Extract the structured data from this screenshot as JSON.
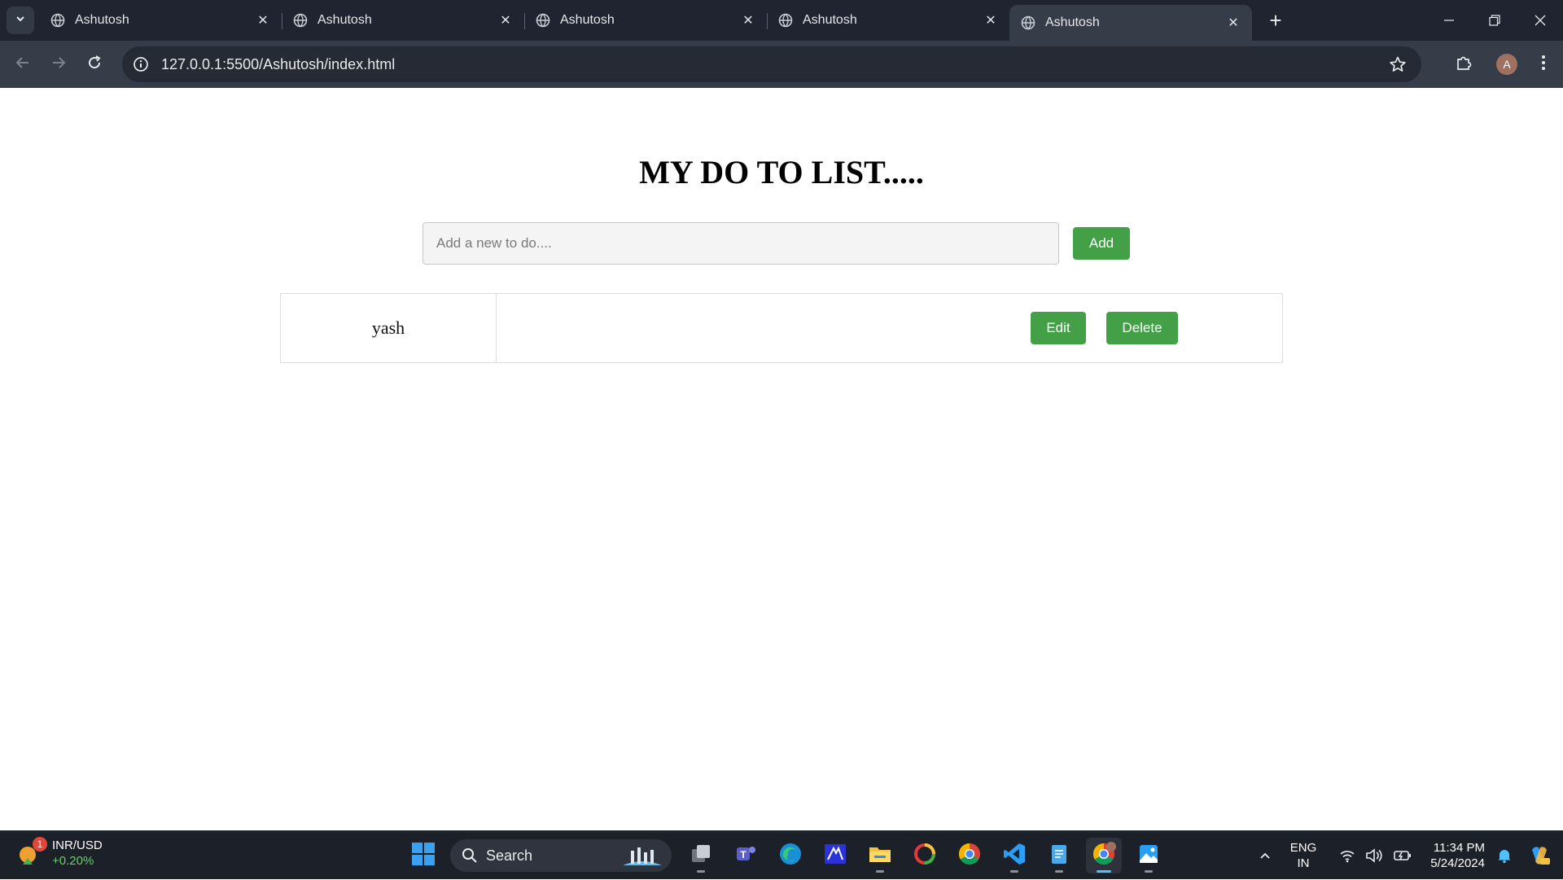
{
  "browser": {
    "tabs": [
      {
        "title": "Ashutosh",
        "active": false
      },
      {
        "title": "Ashutosh",
        "active": false
      },
      {
        "title": "Ashutosh",
        "active": false
      },
      {
        "title": "Ashutosh",
        "active": false
      },
      {
        "title": "Ashutosh",
        "active": true
      }
    ],
    "url": "127.0.0.1:5500/Ashutosh/index.html",
    "profile_initial": "A"
  },
  "page": {
    "title": "MY DO TO LIST.....",
    "input_placeholder": "Add a new to do....",
    "input_value": "",
    "add_label": "Add",
    "todos": [
      {
        "text": "yash",
        "edit_label": "Edit",
        "delete_label": "Delete"
      }
    ],
    "button_color": "#43a047"
  },
  "taskbar": {
    "widget": {
      "title": "INR/USD",
      "change": "+0.20%",
      "badge": "1"
    },
    "search_label": "Search",
    "apps": [
      "task-view",
      "teams",
      "edge",
      "app",
      "file-explorer",
      "app",
      "chrome",
      "vscode",
      "notepad",
      "chrome-profile",
      "photos"
    ],
    "language": {
      "line1": "ENG",
      "line2": "IN"
    },
    "time": "11:34 PM",
    "date": "5/24/2024"
  }
}
